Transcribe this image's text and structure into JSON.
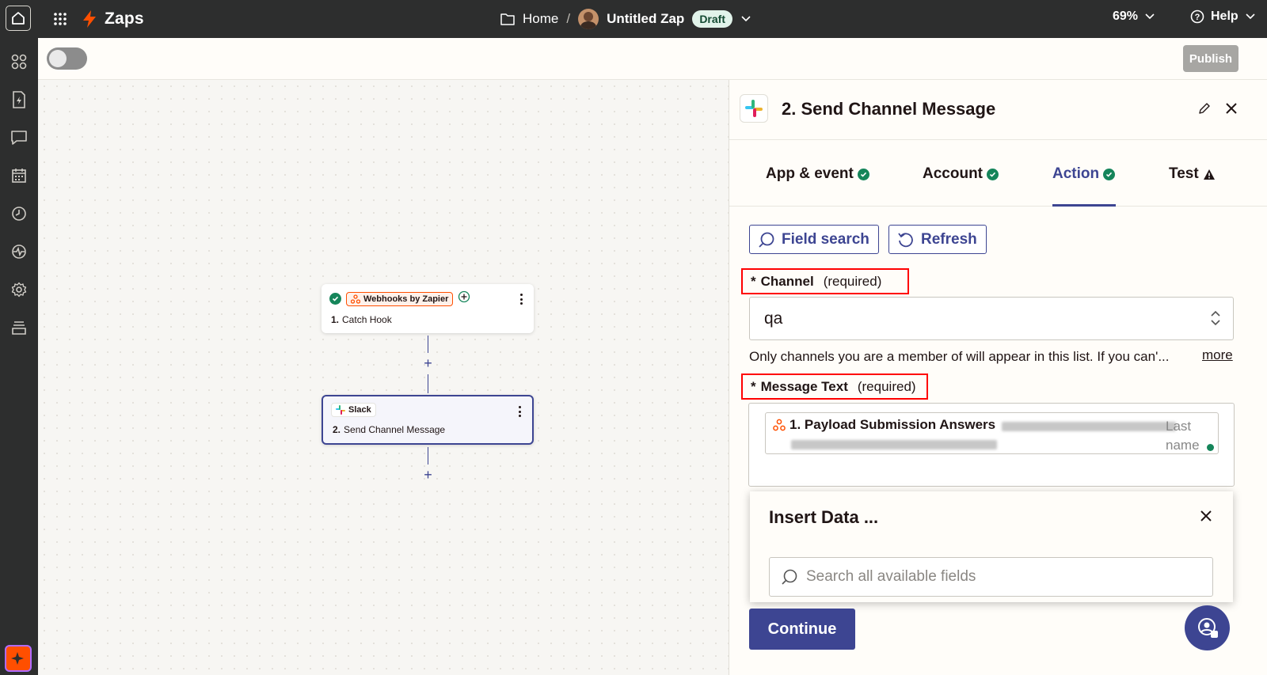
{
  "topbar": {
    "brand": "Zaps",
    "breadcrumb_home": "Home",
    "breadcrumb_sep": "/",
    "zap_name": "Untitled Zap",
    "status_badge": "Draft",
    "zoom": "69%",
    "help": "Help"
  },
  "editor": {
    "publish": "Publish",
    "toggle_on": false
  },
  "canvas": {
    "nodes": [
      {
        "app": "Webhooks by Zapier",
        "step_number": "1.",
        "title": "Catch Hook"
      },
      {
        "app": "Slack",
        "step_number": "2.",
        "title": "Send Channel Message"
      }
    ]
  },
  "panel": {
    "title": "2. Send Channel Message",
    "tabs": [
      {
        "label": "App & event",
        "status": "complete"
      },
      {
        "label": "Account",
        "status": "complete"
      },
      {
        "label": "Action",
        "status": "complete",
        "active": true
      },
      {
        "label": "Test",
        "status": "warning"
      }
    ],
    "field_search": "Field search",
    "refresh": "Refresh",
    "channel": {
      "star": "*",
      "label": "Channel",
      "required": "(required)",
      "value": "qa",
      "help": "Only channels you are a member of will appear in this list. If you can'...",
      "more": "more"
    },
    "message": {
      "star": "*",
      "label": "Message Text",
      "required": "(required)",
      "pill_label": "1. Payload Submission Answers",
      "pill_tail": "Last name"
    },
    "insert_data": {
      "title": "Insert Data ...",
      "search_placeholder": "Search all available fields"
    },
    "continue": "Continue"
  },
  "colors": {
    "accent": "#3d4592",
    "brand": "#ff4f00",
    "success": "#15855a",
    "highlight": "#ff0000"
  }
}
